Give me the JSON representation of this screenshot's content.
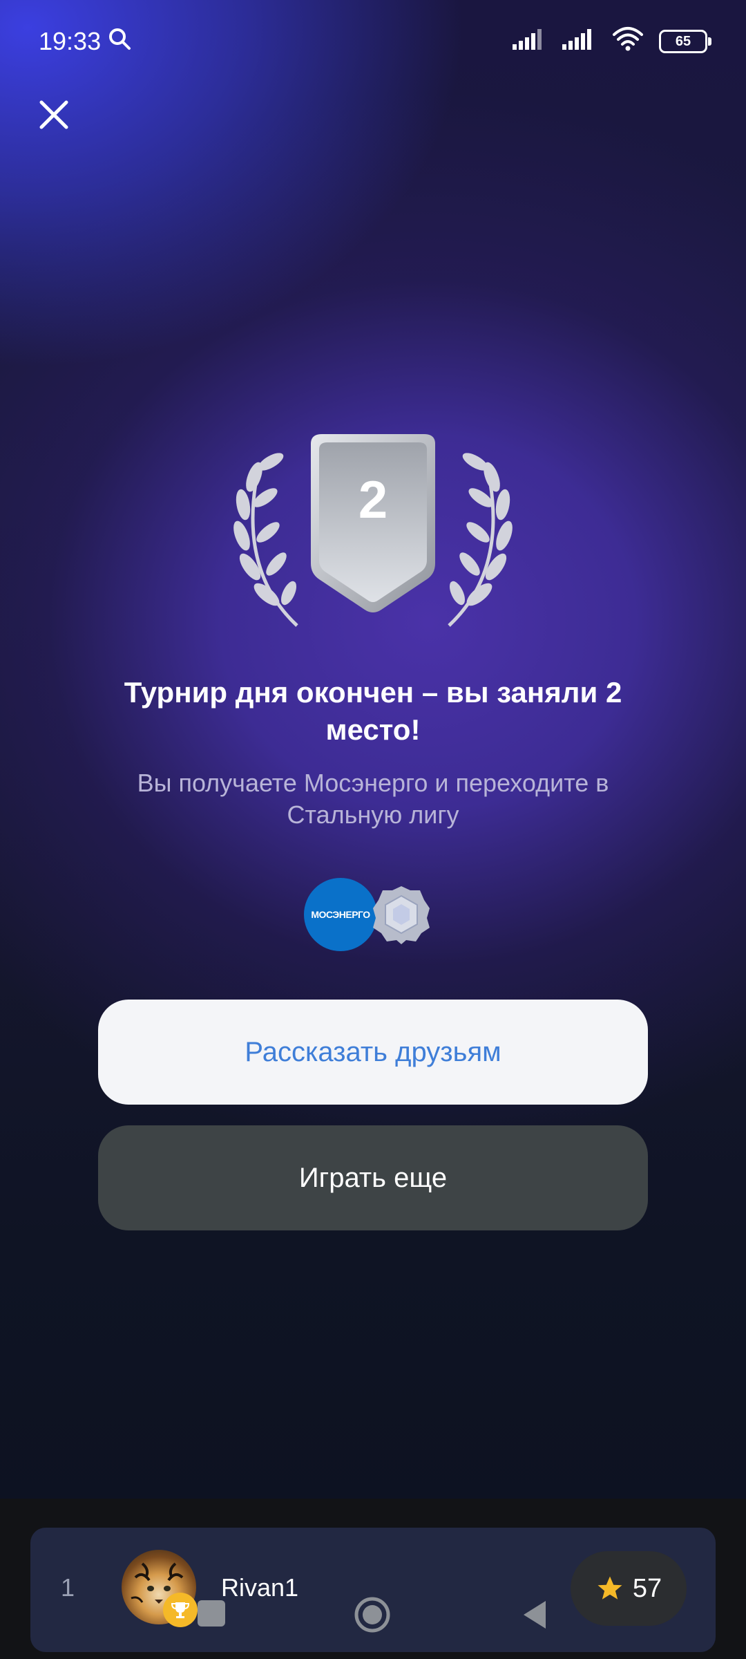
{
  "status_bar": {
    "time": "19:33",
    "battery": "65"
  },
  "result": {
    "place": "2",
    "title": "Турнир дня окончен – вы заняли 2 место!",
    "subtitle": "Вы получаете Мосэнерго и переходите в Стальную лигу"
  },
  "rewards": {
    "sponsor_logo_text": "МОСЭНЕРГО",
    "league_icon": "steel-league-badge-icon"
  },
  "buttons": {
    "share_label": "Рассказать друзьям",
    "play_label": "Играть еще"
  },
  "leaderboard": {
    "rank": "1",
    "username": "Rivan1",
    "score": "57"
  },
  "colors": {
    "accent_blue": "#3f7ed8",
    "background_purple": "#4a32a8",
    "gold": "#f5b928",
    "sponsor_blue": "#0a71c9"
  }
}
